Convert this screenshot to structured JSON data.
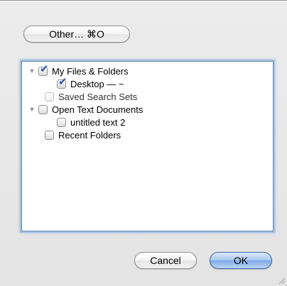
{
  "other_button": {
    "label": "Other… ⌘O"
  },
  "tree": [
    {
      "label": "My Files & Folders",
      "checked": true,
      "disclosure": "expanded"
    },
    {
      "label": "Desktop — ~",
      "checked": true
    },
    {
      "label": "Saved Search Sets",
      "checked": false
    },
    {
      "label": "Open Text Documents",
      "checked": false,
      "disclosure": "expanded"
    },
    {
      "label": "untitled text 2",
      "checked": false
    },
    {
      "label": "Recent Folders",
      "checked": false
    }
  ],
  "buttons": {
    "cancel": "Cancel",
    "ok": "OK"
  },
  "colors": {
    "default_button": "#7ea9e4",
    "check_mark": "#2b57b0",
    "focus_ring": "#9fbfe8"
  }
}
